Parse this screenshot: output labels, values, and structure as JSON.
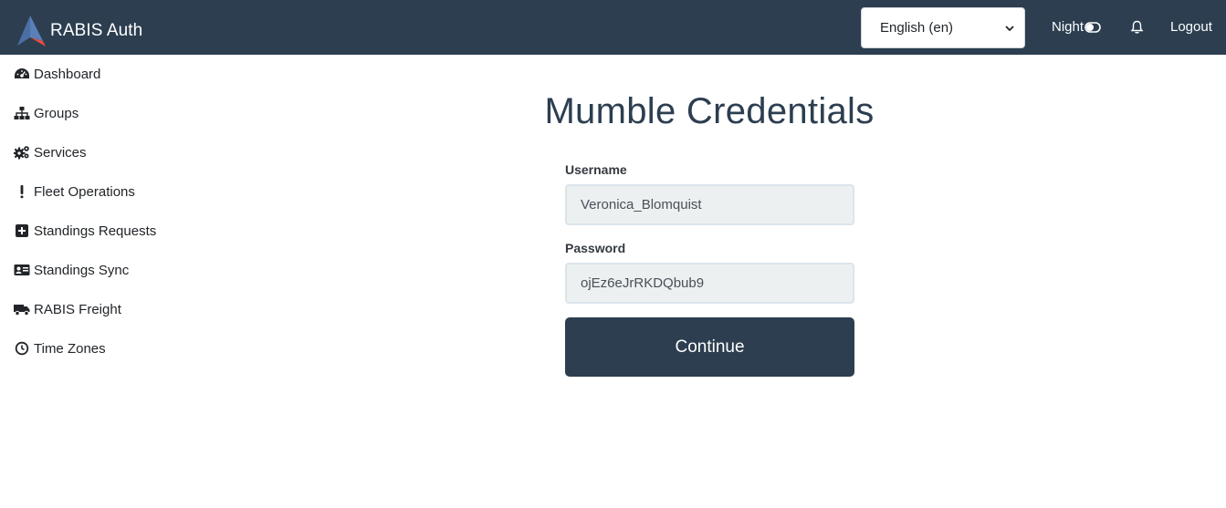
{
  "header": {
    "brand": "RABIS Auth",
    "language_select": "English (en)",
    "night_label": "Night",
    "logout_label": "Logout"
  },
  "sidebar": {
    "items": [
      {
        "label": "Dashboard",
        "icon": "dashboard-icon"
      },
      {
        "label": "Groups",
        "icon": "sitemap-icon"
      },
      {
        "label": "Services",
        "icon": "cogs-icon"
      },
      {
        "label": "Fleet Operations",
        "icon": "exclamation-icon"
      },
      {
        "label": "Standings Requests",
        "icon": "plus-square-icon"
      },
      {
        "label": "Standings Sync",
        "icon": "id-card-icon"
      },
      {
        "label": "RABIS Freight",
        "icon": "truck-icon"
      },
      {
        "label": "Time Zones",
        "icon": "clock-icon"
      }
    ]
  },
  "main": {
    "title": "Mumble Credentials",
    "username_label": "Username",
    "username_value": "Veronica_Blomquist",
    "password_label": "Password",
    "password_value": "ojEz6eJrRKDQbub9",
    "continue_label": "Continue"
  },
  "colors": {
    "navbar": "#2c3e50",
    "button": "#2c3e50",
    "input_bg": "#ecf0f1",
    "title": "#2c3e50"
  }
}
